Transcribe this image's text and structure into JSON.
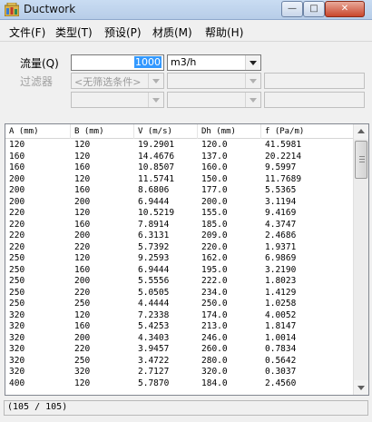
{
  "window": {
    "title": "Ductwork",
    "min_glyph": "—",
    "max_glyph": "□",
    "close_glyph": "✕"
  },
  "menu": [
    "文件(F)",
    "类型(T)",
    "预设(P)",
    "材质(M)",
    "帮助(H)"
  ],
  "flow": {
    "label": "流量(Q)",
    "value": "1000",
    "unit": "m3/h"
  },
  "filter": {
    "label": "过滤器",
    "condition": "<无筛选条件>"
  },
  "table": {
    "columns": [
      "A (mm)",
      "B (mm)",
      "V (m/s)",
      "Dh (mm)",
      "f (Pa/m)"
    ],
    "rows": [
      [
        "120",
        "120",
        "19.2901",
        "120.0",
        "41.5981"
      ],
      [
        "160",
        "120",
        "14.4676",
        "137.0",
        "20.2214"
      ],
      [
        "160",
        "160",
        "10.8507",
        "160.0",
        "9.5997"
      ],
      [
        "200",
        "120",
        "11.5741",
        "150.0",
        "11.7689"
      ],
      [
        "200",
        "160",
        "8.6806",
        "177.0",
        "5.5365"
      ],
      [
        "200",
        "200",
        "6.9444",
        "200.0",
        "3.1194"
      ],
      [
        "220",
        "120",
        "10.5219",
        "155.0",
        "9.4169"
      ],
      [
        "220",
        "160",
        "7.8914",
        "185.0",
        "4.3747"
      ],
      [
        "220",
        "200",
        "6.3131",
        "209.0",
        "2.4686"
      ],
      [
        "220",
        "220",
        "5.7392",
        "220.0",
        "1.9371"
      ],
      [
        "250",
        "120",
        "9.2593",
        "162.0",
        "6.9869"
      ],
      [
        "250",
        "160",
        "6.9444",
        "195.0",
        "3.2190"
      ],
      [
        "250",
        "200",
        "5.5556",
        "222.0",
        "1.8023"
      ],
      [
        "250",
        "220",
        "5.0505",
        "234.0",
        "1.4129"
      ],
      [
        "250",
        "250",
        "4.4444",
        "250.0",
        "1.0258"
      ],
      [
        "320",
        "120",
        "7.2338",
        "174.0",
        "4.0052"
      ],
      [
        "320",
        "160",
        "5.4253",
        "213.0",
        "1.8147"
      ],
      [
        "320",
        "200",
        "4.3403",
        "246.0",
        "1.0014"
      ],
      [
        "320",
        "220",
        "3.9457",
        "260.0",
        "0.7834"
      ],
      [
        "320",
        "250",
        "3.4722",
        "280.0",
        "0.5642"
      ],
      [
        "320",
        "320",
        "2.7127",
        "320.0",
        "0.3037"
      ],
      [
        "400",
        "120",
        "5.7870",
        "184.0",
        "2.4560"
      ]
    ]
  },
  "status": "(105 / 105)"
}
